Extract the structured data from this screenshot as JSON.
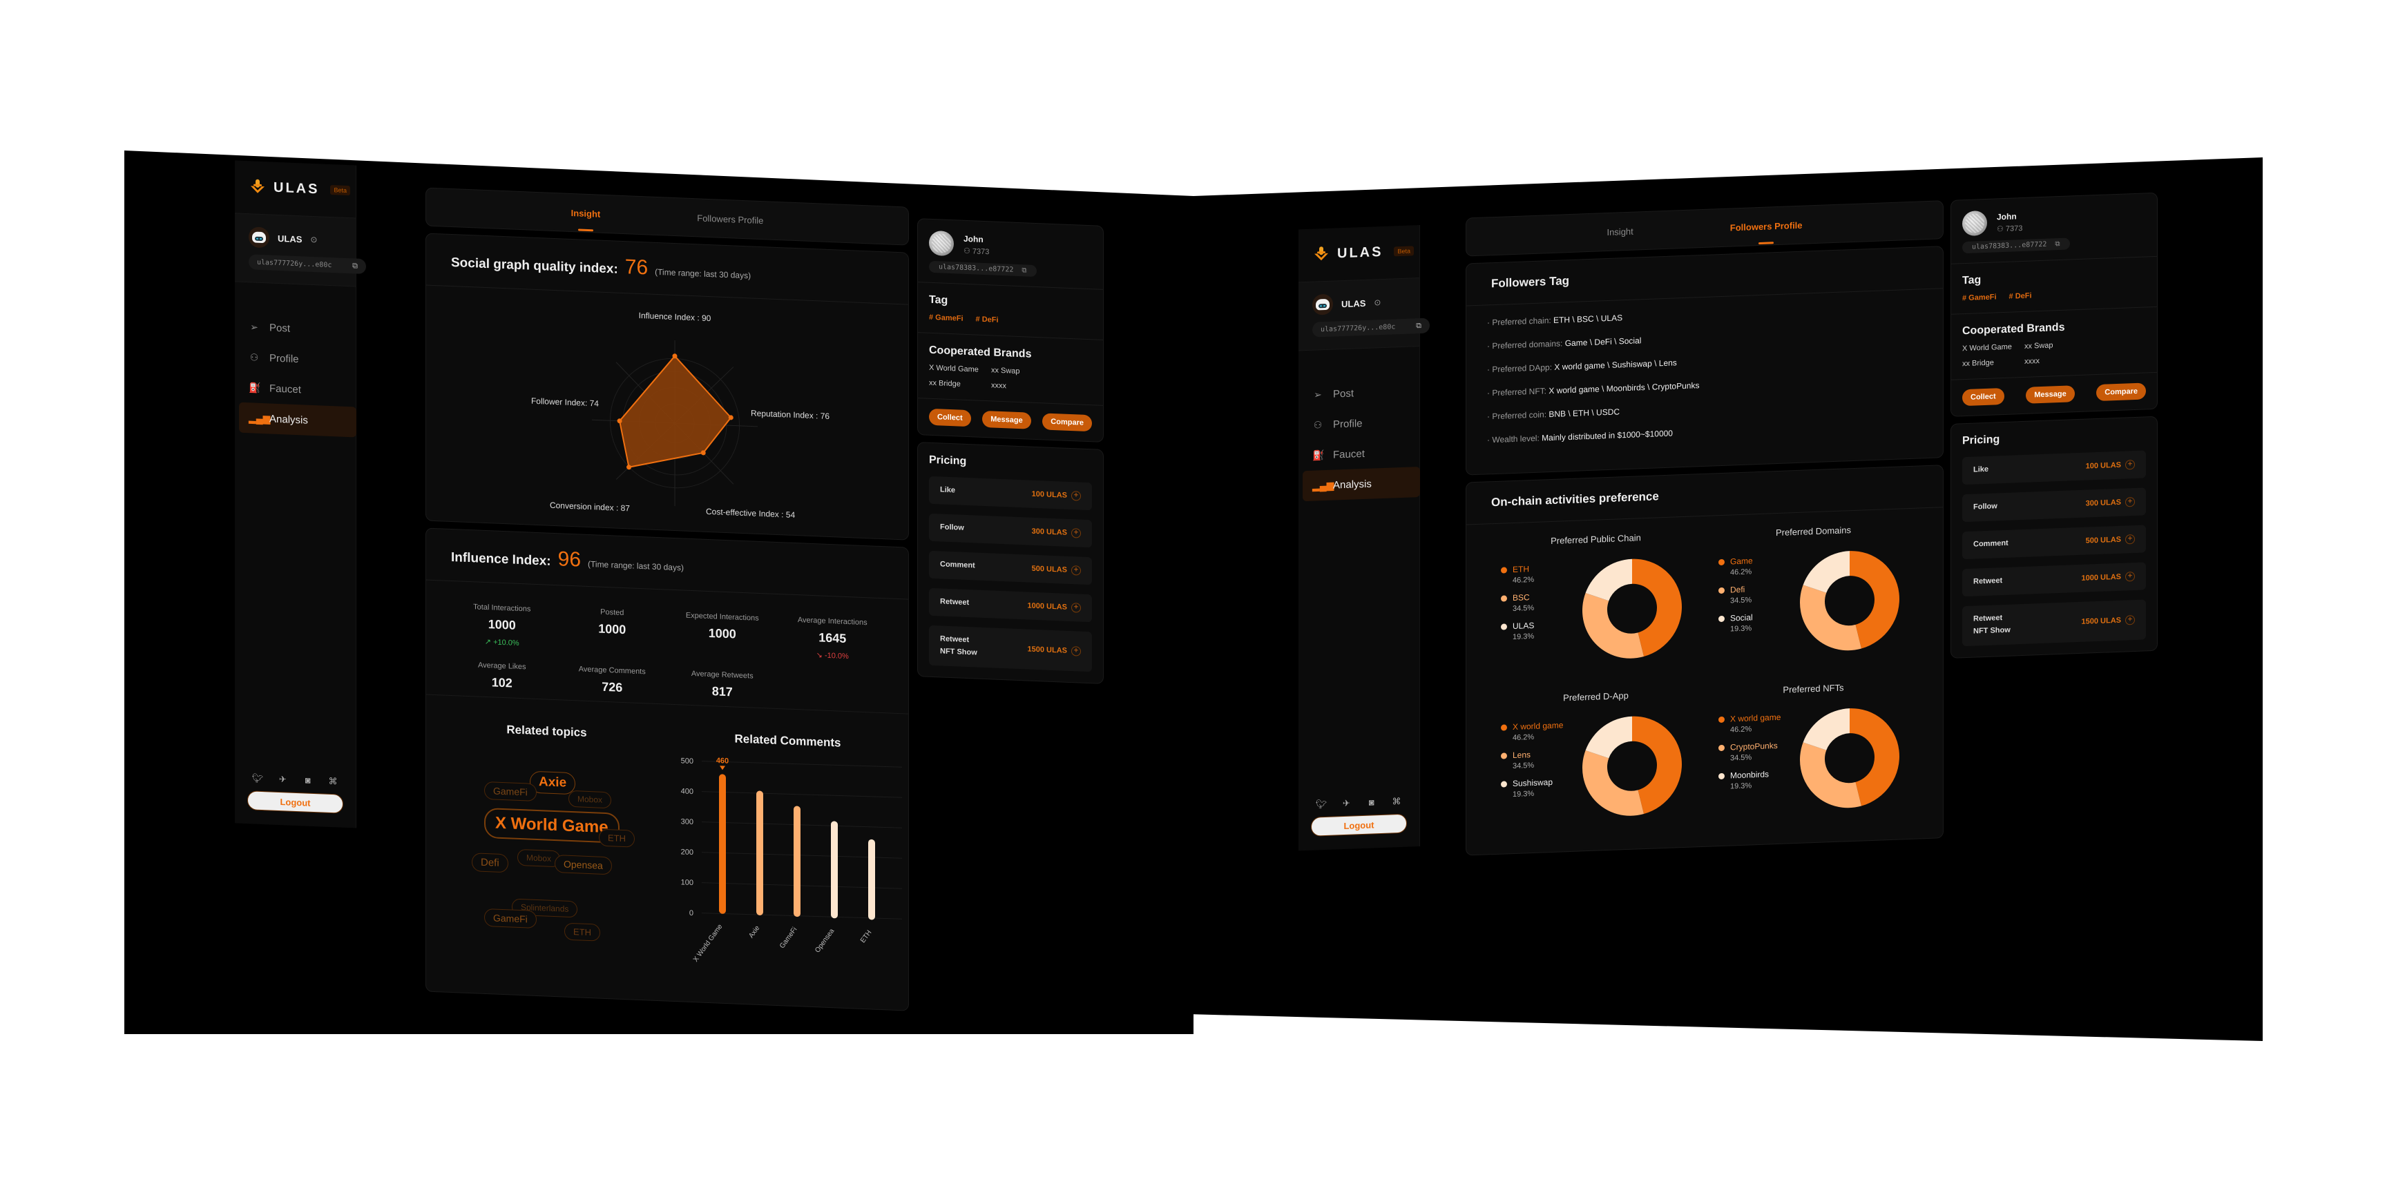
{
  "brand": {
    "name": "ULAS",
    "badge": "Beta"
  },
  "user": {
    "name": "ULAS",
    "address": "ulas777726y...e80c"
  },
  "nav": [
    {
      "label": "Post",
      "icon": "send-icon"
    },
    {
      "label": "Profile",
      "icon": "user-icon"
    },
    {
      "label": "Faucet",
      "icon": "faucet-icon"
    },
    {
      "label": "Analysis",
      "icon": "bar-chart-icon",
      "active": true
    }
  ],
  "socials": [
    "twitter-icon",
    "telegram-icon",
    "discord-icon",
    "github-icon"
  ],
  "logout_label": "Logout",
  "tabs": {
    "insight": "Insight",
    "followers": "Followers Profile"
  },
  "colors": {
    "accent": "#f07010",
    "light": "#ffb070",
    "pale": "#fde6cf",
    "bg": "#000000",
    "card": "#0c0c0c"
  },
  "insight": {
    "sgqi": {
      "title": "Social graph quality index:",
      "value": "76",
      "range": "(Time range: last 30 days)"
    },
    "influence": {
      "title": "Influence Index:",
      "value": "96",
      "range": "(Time range: last 30 days)",
      "stats": [
        {
          "label": "Total Interactions",
          "value": "1000",
          "change": "↗ +10.0%",
          "dir": "up"
        },
        {
          "label": "Posted",
          "value": "1000",
          "change": "",
          "dir": ""
        },
        {
          "label": "Expected Interactions",
          "value": "1000",
          "change": "",
          "dir": ""
        },
        {
          "label": "Average Interactions",
          "value": "1645",
          "change": "↘ -10.0%",
          "dir": "down"
        },
        {
          "label": "Average Likes",
          "value": "102",
          "change": "",
          "dir": ""
        },
        {
          "label": "Average Comments",
          "value": "726",
          "change": "",
          "dir": ""
        },
        {
          "label": "Average Retweets",
          "value": "817",
          "change": "",
          "dir": ""
        }
      ]
    },
    "topics": {
      "title": "Related topics",
      "items": [
        "Axie",
        "GameFi",
        "Mobox",
        "X World Game",
        "ETH",
        "Defi",
        "Mobox",
        "Opensea",
        "Splinterlands",
        "GameFi",
        "ETH"
      ]
    },
    "comments_title": "Related Comments"
  },
  "profile": {
    "name": "John",
    "followers": "7373",
    "address": "ulas78383...e87722",
    "tag_title": "Tag",
    "tags": [
      "# GameFi",
      "# DeFi"
    ],
    "brands_title": "Cooperated Brands",
    "brands": [
      "X World Game",
      "xx Swap",
      "xx Bridge",
      "xxxx"
    ],
    "buttons": {
      "collect": "Collect",
      "message": "Message",
      "compare": "Compare"
    }
  },
  "pricing": {
    "title": "Pricing",
    "rows": [
      {
        "label": "Like",
        "label2": "",
        "price": "100 ULAS"
      },
      {
        "label": "Follow",
        "label2": "",
        "price": "300 ULAS"
      },
      {
        "label": "Comment",
        "label2": "",
        "price": "500 ULAS"
      },
      {
        "label": "Retweet",
        "label2": "",
        "price": "1000 ULAS"
      },
      {
        "label": "Retweet",
        "label2": "NFT Show",
        "price": "1500 ULAS"
      }
    ]
  },
  "followers_profile": {
    "tag_title": "Followers Tag",
    "tags": [
      {
        "k": "· Preferred chain: ",
        "v": "ETH \\ BSC \\ ULAS"
      },
      {
        "k": "· Preferred domains: ",
        "v": "Game \\ DeFi \\ Social"
      },
      {
        "k": "· Preferred DApp: ",
        "v": "X world game \\ Sushiswap \\ Lens"
      },
      {
        "k": "· Preferred NFT: ",
        "v": "X world game \\ Moonbirds \\ CryptoPunks"
      },
      {
        "k": "· Preferred coin: ",
        "v": "BNB \\ ETH \\ USDC"
      },
      {
        "k": "· Wealth level: ",
        "v": "Mainly distributed in $1000~$10000"
      }
    ],
    "onchain_title": "On-chain activities preference"
  },
  "chart_data": [
    {
      "type": "radar",
      "title": "Social graph quality index",
      "axes": [
        "Influence Index",
        "Reputation Index",
        "Cost-effective Index",
        "Conversion index",
        "Follower Index"
      ],
      "labels": [
        "Influence Index : 90",
        "Reputation Index : 76",
        "Cost-effective Index : 54",
        "Conversion index : 87",
        "Follower Index: 74"
      ],
      "values": [
        90,
        76,
        54,
        87,
        74
      ],
      "range": [
        0,
        100
      ]
    },
    {
      "type": "bar",
      "title": "Related Comments",
      "categories": [
        "X World Game",
        "Axie",
        "GameFi",
        "Opensea",
        "ETH"
      ],
      "values": [
        460,
        410,
        365,
        320,
        265
      ],
      "highlight_label": "460",
      "yticks": [
        0,
        100,
        200,
        300,
        400,
        500
      ],
      "ylim": [
        0,
        500
      ],
      "grid": true
    },
    {
      "type": "pie",
      "title": "Preferred Public Chain",
      "labels": [
        "ETH",
        "BSC",
        "ULAS"
      ],
      "values": [
        46.2,
        34.5,
        19.3
      ],
      "pct": [
        "46.2%",
        "34.5%",
        "19.3%"
      ]
    },
    {
      "type": "pie",
      "title": "Preferred Domains",
      "labels": [
        "Game",
        "Defi",
        "Social"
      ],
      "values": [
        46.2,
        34.5,
        19.3
      ],
      "pct": [
        "46.2%",
        "34.5%",
        "19.3%"
      ]
    },
    {
      "type": "pie",
      "title": "Preferred D-App",
      "labels": [
        "X world game",
        "Lens",
        "Sushiswap"
      ],
      "values": [
        46.2,
        34.5,
        19.3
      ],
      "pct": [
        "46.2%",
        "34.5%",
        "19.3%"
      ]
    },
    {
      "type": "pie",
      "title": "Preferred NFTs",
      "labels": [
        "X world game",
        "CryptoPunks",
        "Moonbirds"
      ],
      "values": [
        46.2,
        34.5,
        19.3
      ],
      "pct": [
        "46.2%",
        "34.5%",
        "19.3%"
      ]
    }
  ]
}
